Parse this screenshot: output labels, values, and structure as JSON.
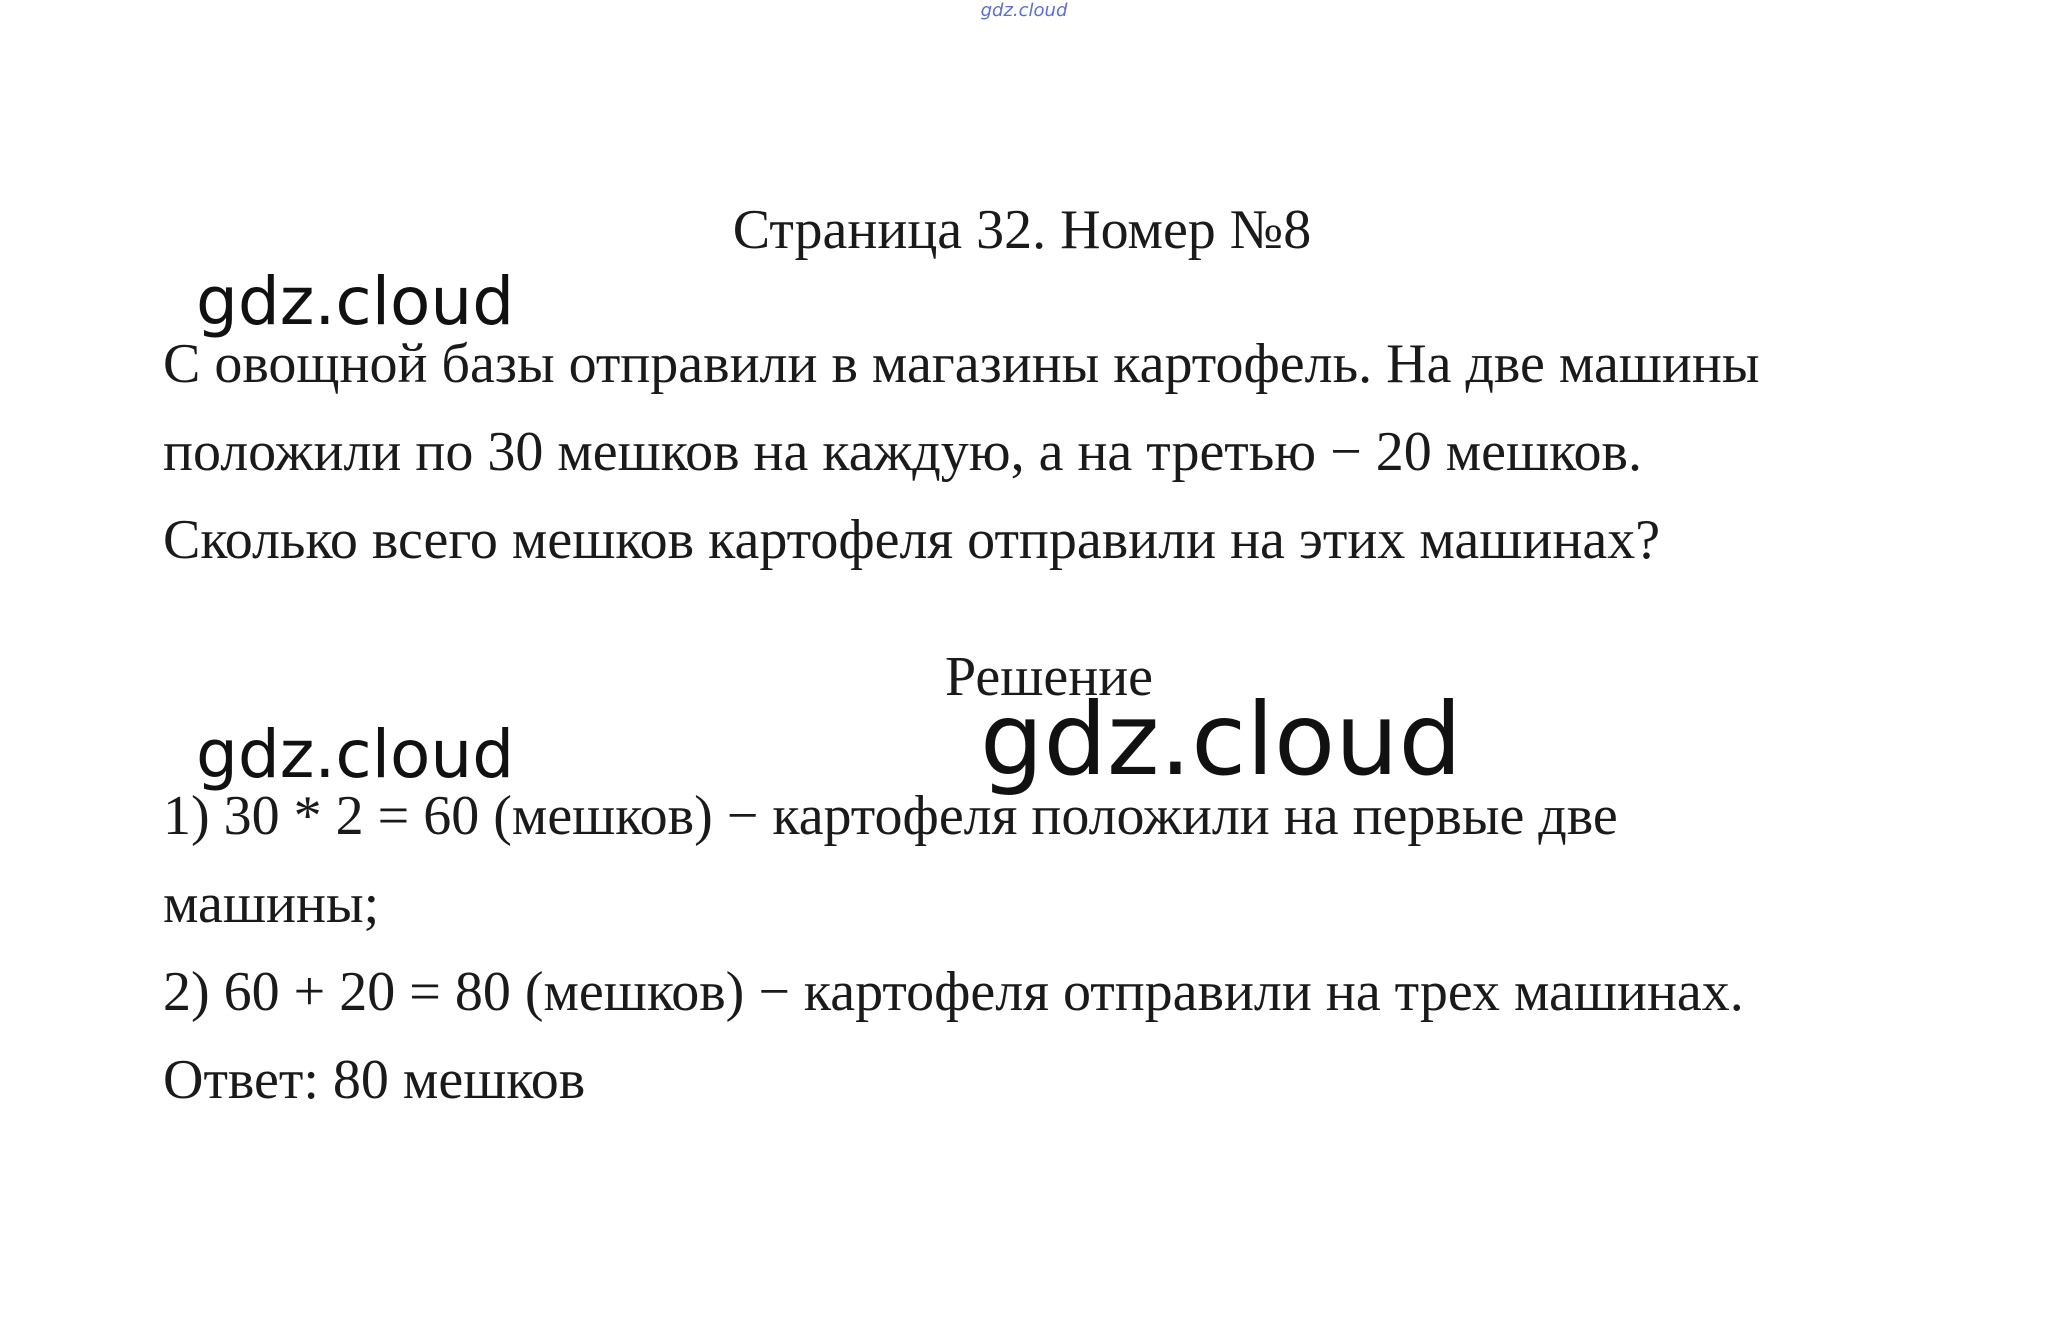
{
  "watermark_small": "gdz.cloud",
  "heading": "Страница 32. Номер №8",
  "watermark": "gdz.cloud",
  "problem_lines": [
    "С овощной базы отправили в магазины картофель. На две машины",
    "положили по 30 мешков на каждую, а на третью − 20 мешков.",
    "Сколько всего мешков картофеля отправили на этих машинах?"
  ],
  "solution_title": "Решение",
  "solution_lines": [
    "1) 30 * 2 = 60 (мешков) − картофеля положили на первые две",
    "машины;",
    "2) 60 + 20 = 80 (мешков) − картофеля отправили на трех машинах.",
    "Ответ: 80 мешков"
  ]
}
